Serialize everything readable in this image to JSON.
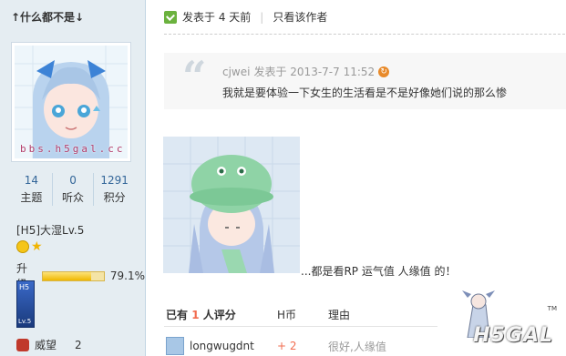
{
  "sidebar": {
    "username": "↑什么都不是↓",
    "avatar_watermark": "bbs.h5gal.cc",
    "stats": [
      {
        "value": "14",
        "label": "主题"
      },
      {
        "value": "0",
        "label": "听众"
      },
      {
        "value": "1291",
        "label": "积分"
      }
    ],
    "group": "[H5]大湿Lv.5",
    "level_label": "升级",
    "level_percent": "79.1%",
    "level_fraction": 0.791,
    "badge_top": "H5",
    "badge_bottom": "Lv.5",
    "prestige_label": "威望",
    "prestige_value": "2"
  },
  "post": {
    "posted": "发表于 4 天前",
    "only_author": "只看该作者",
    "quote": {
      "author": "cjwei",
      "time": "发表于 2013-7-7 11:52",
      "text": "我就是要体验一下女生的生活看是不是好像她们说的那么惨"
    },
    "body_text": "...都是看RP 运气值 人缘值 的！"
  },
  "rating": {
    "prefix": "已有",
    "count": "1",
    "suffix": "人评分",
    "col_coin": "H币",
    "col_reason": "理由",
    "rows": [
      {
        "user": "longwugdnt",
        "score": "+ 2",
        "reason": "很好,人缘值"
      }
    ]
  },
  "watermark": {
    "text": "H5GAL",
    "tm": "TM"
  },
  "colors": {
    "sidebar_bg": "#e5edf2",
    "accent": "#f26c4f",
    "link": "#336699"
  }
}
